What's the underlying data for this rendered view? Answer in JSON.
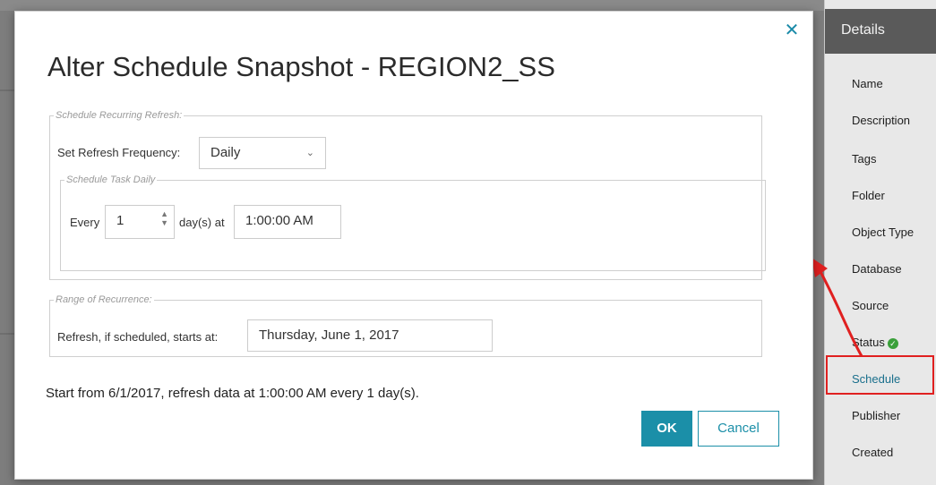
{
  "dialog": {
    "title": "Alter Schedule Snapshot - REGION2_SS",
    "close_icon": "close-icon",
    "recurring": {
      "legend": "Schedule Recurring Refresh:",
      "frequency_label": "Set Refresh Frequency:",
      "frequency_value": "Daily",
      "daily": {
        "legend": "Schedule Task Daily",
        "every_label": "Every",
        "every_value": "1",
        "days_label": "day(s) at",
        "time_value": "1:00:00 AM"
      }
    },
    "range": {
      "legend": "Range of Recurrence:",
      "starts_label": "Refresh, if scheduled, starts at:",
      "starts_value": "Thursday, June 1, 2017"
    },
    "summary": "Start from 6/1/2017, refresh data at 1:00:00 AM every 1 day(s).",
    "ok_label": "OK",
    "cancel_label": "Cancel"
  },
  "details": {
    "header": "Details",
    "items": [
      "Name",
      "Description",
      "Tags",
      "Folder",
      "Object Type",
      "Database",
      "Source",
      "Status",
      "Schedule",
      "Publisher",
      "Created"
    ],
    "status_icon": "check-circle-icon"
  },
  "colors": {
    "accent": "#1b8fa8",
    "highlight": "#e02020",
    "status_ok": "#3aa03a"
  }
}
